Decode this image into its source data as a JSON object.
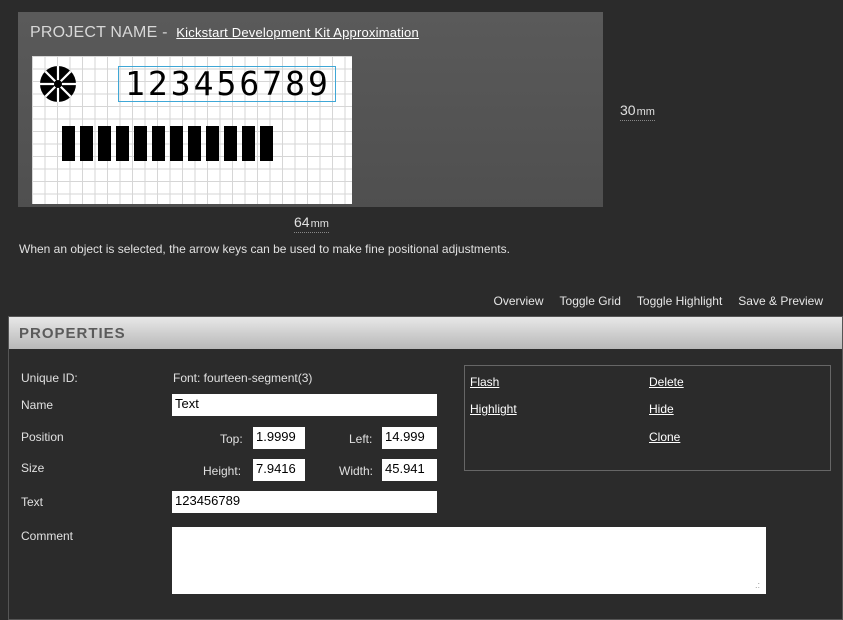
{
  "project": {
    "label": "PROJECT NAME -",
    "name": "Kickstart Development Kit Approximation"
  },
  "lcd": {
    "digits": "123456789",
    "bar_count": 12
  },
  "dimensions": {
    "height_value": "30",
    "height_unit": "mm",
    "width_value": "64",
    "width_unit": "mm"
  },
  "hint": "When an object is selected, the arrow keys can be used to make fine positional adjustments.",
  "toolbar": {
    "overview": "Overview",
    "toggle_grid": "Toggle Grid",
    "toggle_highlight": "Toggle Highlight",
    "save_preview": "Save & Preview"
  },
  "properties": {
    "header": "PROPERTIES",
    "unique_id_label": "Unique ID:",
    "unique_id_value": "Font: fourteen-segment(3)",
    "name_label": "Name",
    "name_value": "Text",
    "position_label": "Position",
    "top_label": "Top:",
    "top_value": "1.9999",
    "left_label": "Left:",
    "left_value": "14.999",
    "size_label": "Size",
    "height_label": "Height:",
    "height_value": "7.9416",
    "width_label": "Width:",
    "width_value": "45.941",
    "text_label": "Text",
    "text_value": "123456789",
    "comment_label": "Comment",
    "comment_value": ""
  },
  "actions": {
    "flash": "Flash",
    "highlight": "Highlight",
    "delete": "Delete",
    "hide": "Hide",
    "clone": "Clone"
  }
}
